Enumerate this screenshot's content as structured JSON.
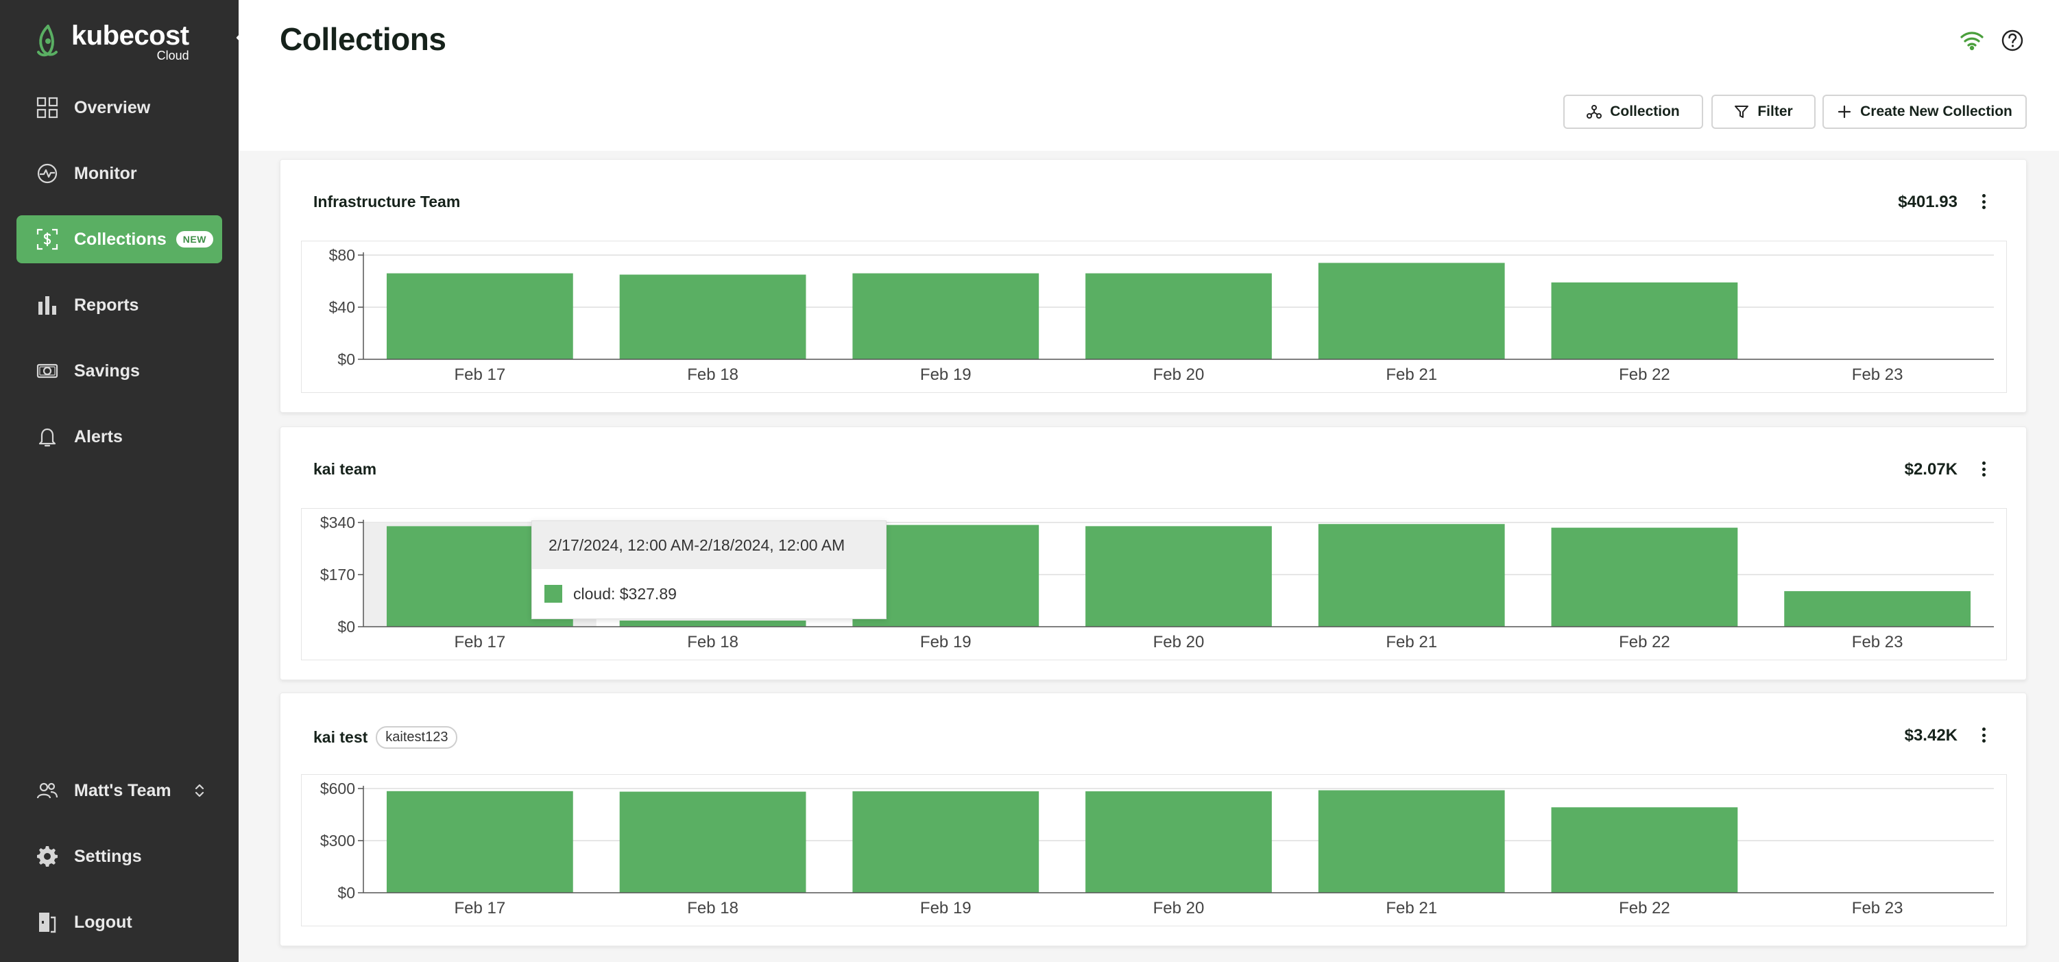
{
  "sidebar": {
    "logo_name": "kubecost",
    "logo_sub": "Cloud",
    "items": [
      {
        "label": "Overview",
        "icon": "grid-icon"
      },
      {
        "label": "Monitor",
        "icon": "pulse-icon"
      },
      {
        "label": "Collections",
        "icon": "dollar-frame-icon",
        "badge": "NEW",
        "active": true
      },
      {
        "label": "Reports",
        "icon": "bar-chart-icon"
      },
      {
        "label": "Savings",
        "icon": "cash-icon"
      },
      {
        "label": "Alerts",
        "icon": "bell-icon"
      }
    ],
    "team": {
      "label": "Matt's Team",
      "icon": "users-icon"
    },
    "settings": {
      "label": "Settings",
      "icon": "gear-icon"
    },
    "logout": {
      "label": "Logout",
      "icon": "logout-icon"
    }
  },
  "header": {
    "title": "Collections"
  },
  "actions": {
    "collection_label": "Collection",
    "filter_label": "Filter",
    "create_label": "Create New Collection"
  },
  "colors": {
    "accent": "#5aaf63",
    "sidebar_bg": "#2e2e2e",
    "bar": "#5aaf63"
  },
  "collections": [
    {
      "name": "Infrastructure Team",
      "tag": "",
      "total": "$401.93"
    },
    {
      "name": "kai team",
      "tag": "",
      "total": "$2.07K"
    },
    {
      "name": "kai test",
      "tag": "kaitest123",
      "total": "$3.42K"
    }
  ],
  "chart_data": [
    {
      "type": "bar",
      "title": "Infrastructure Team",
      "categories": [
        "Feb 17",
        "Feb 18",
        "Feb 19",
        "Feb 20",
        "Feb 21",
        "Feb 22",
        "Feb 23"
      ],
      "values": [
        66,
        65,
        66,
        66,
        74,
        59,
        0
      ],
      "yticks": [
        "$0",
        "$40",
        "$80"
      ],
      "ylim": [
        0,
        80
      ],
      "grid": true
    },
    {
      "type": "bar",
      "title": "kai team",
      "categories": [
        "Feb 17",
        "Feb 18",
        "Feb 19",
        "Feb 20",
        "Feb 21",
        "Feb 22",
        "Feb 23"
      ],
      "values": [
        327.89,
        20,
        332,
        328,
        335,
        323,
        116
      ],
      "yticks": [
        "$0",
        "$170",
        "$340"
      ],
      "ylim": [
        0,
        340
      ],
      "grid": true,
      "tooltip": {
        "range": "2/17/2024, 12:00 AM-2/18/2024, 12:00 AM",
        "series": "cloud",
        "value": "$327.89",
        "text": "cloud: $327.89"
      }
    },
    {
      "type": "bar",
      "title": "kai test",
      "categories": [
        "Feb 17",
        "Feb 18",
        "Feb 19",
        "Feb 20",
        "Feb 21",
        "Feb 22",
        "Feb 23"
      ],
      "values": [
        585,
        582,
        584,
        584,
        590,
        492,
        0
      ],
      "yticks": [
        "$0",
        "$300",
        "$600"
      ],
      "ylim": [
        0,
        600
      ],
      "grid": true
    }
  ]
}
